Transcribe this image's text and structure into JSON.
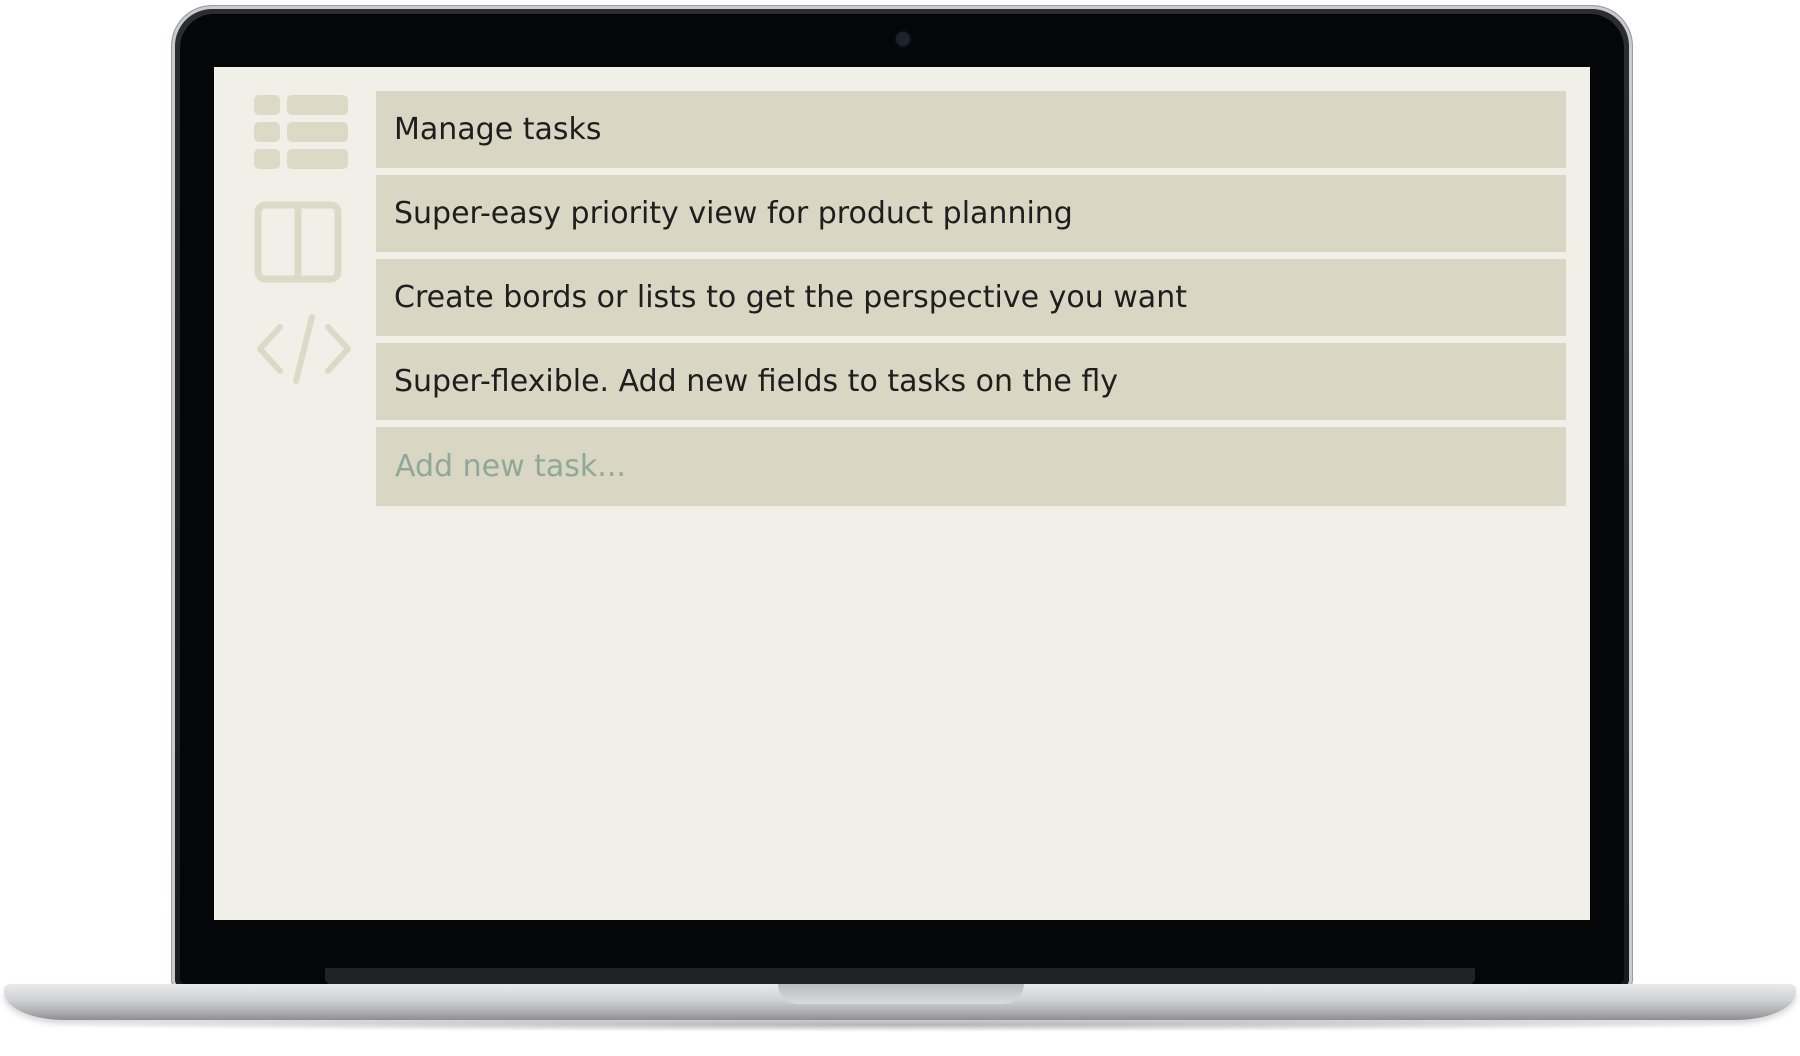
{
  "tasks": [
    {
      "label": "Manage tasks"
    },
    {
      "label": "Super-easy priority view for product planning"
    },
    {
      "label": "Create bords or lists to get the perspective you want"
    },
    {
      "label": "Super-flexible. Add new fields to tasks on the fly"
    }
  ],
  "new_task": {
    "placeholder": "Add new task...",
    "value": ""
  },
  "sidebar": {
    "icons": [
      "list-view-icon",
      "board-view-icon",
      "code-icon"
    ]
  },
  "colors": {
    "screen_bg": "#f1f0e8",
    "task_bg": "#d9d6c3",
    "icon": "#dcd9c7",
    "placeholder": "#8fa899"
  }
}
